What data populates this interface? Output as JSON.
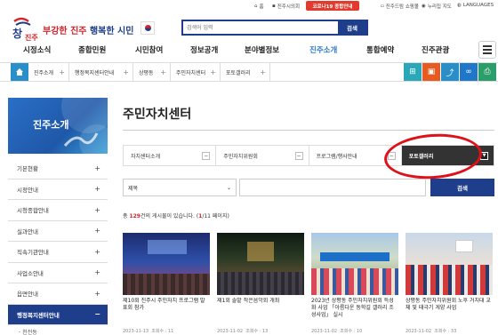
{
  "utility": {
    "home": "홈",
    "mayor": "진주시의회",
    "covid": "코로나19 종합안내",
    "mall": "진주드림 쇼핑몰",
    "nuri": "누리집 지도",
    "lang": "LANGUAGES"
  },
  "header": {
    "slogan_red": "부강한 진주",
    "slogan_blue": "행복한 시민",
    "search_placeholder": "검색어 입력",
    "search_button": "검색"
  },
  "gnb": [
    "시정소식",
    "종합민원",
    "시민참여",
    "정보공개",
    "분야별정보",
    "진주소개",
    "통합예약",
    "진주관광"
  ],
  "gnb_active": "진주소개",
  "breadcrumb": [
    "진주소개",
    "행정복지센터안내",
    "상평동",
    "주민자치센터",
    "포토갤러리"
  ],
  "sidebar": {
    "title": "진주소개",
    "items": [
      {
        "label": "기본현황",
        "active": false
      },
      {
        "label": "시정안내",
        "active": false
      },
      {
        "label": "시청종합안내",
        "active": false
      },
      {
        "label": "실과안내",
        "active": false
      },
      {
        "label": "직속기관안내",
        "active": false
      },
      {
        "label": "사업소안내",
        "active": false
      },
      {
        "label": "읍면안내",
        "active": false
      },
      {
        "label": "행정복지센터안내",
        "active": true
      }
    ],
    "sub_item": "천전동"
  },
  "content": {
    "title": "주민자치센터",
    "tabs": [
      {
        "label": "자치센터소개",
        "active": false
      },
      {
        "label": "주민자치위원회",
        "active": false
      },
      {
        "label": "프로그램/행사안내",
        "active": false
      },
      {
        "label": "포토갤러리",
        "active": true
      }
    ],
    "filter_select": "제목",
    "filter_button": "검색",
    "count_prefix": "총",
    "count_total": "129",
    "count_suffix": "건의 게시물이 있습니다. (",
    "count_page": "1",
    "count_pages": "/11 페이지)"
  },
  "gallery": [
    {
      "caption": "제10회 진주시 주민자치 프로그램 발표회 참가",
      "date": "2023-11-13",
      "views": "조회수 : 11"
    },
    {
      "caption": "제1회 솔밭 작은음악회 개최",
      "date": "2023-11-02",
      "views": "조회수 : 13"
    },
    {
      "caption": "2023년 상평동 주민자치위원회 특성화 사업 「아름다운 동학길 갤러리 조성사업」 실시",
      "date": "2023-11-02",
      "views": "조회수 : 10"
    },
    {
      "caption": "상평동 주민자치위원회 노후 거치대 교체 및 태극기 게양 사업",
      "date": "2023-11-02",
      "views": "조회수 : 33"
    }
  ],
  "colors": {
    "navy": "#1e3e8c",
    "red": "#d3242a",
    "teal": "#2a8fc9",
    "dark_tab": "#333333"
  }
}
